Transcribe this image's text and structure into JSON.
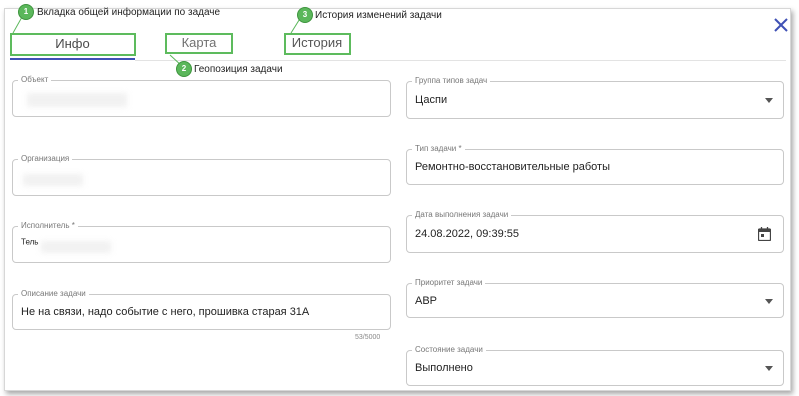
{
  "tabs": {
    "info": "Инфо",
    "map": "Карта",
    "history": "История"
  },
  "annotations": [
    {
      "number": "1",
      "text": "Вкладка общей информации по задаче"
    },
    {
      "number": "2",
      "text": "Геопозиция задачи"
    },
    {
      "number": "3",
      "text": "История изменений задачи"
    }
  ],
  "left_column": {
    "object": {
      "label": "Объект",
      "value": ""
    },
    "organization": {
      "label": "Организация",
      "value": ""
    },
    "executor": {
      "label": "Исполнитель *",
      "value": "Тель"
    },
    "description": {
      "label": "Описание задачи",
      "value": "Не на связи, надо событие с него, прошивка старая 31А",
      "counter": "53/5000"
    }
  },
  "right_column": {
    "task_type_group": {
      "label": "Группа типов задач",
      "value": "Цаспи"
    },
    "task_type": {
      "label": "Тип задачи *",
      "value": "Ремонтно-восстановительные работы"
    },
    "due_date": {
      "label": "Дата выполнения задачи",
      "value": "24.08.2022, 09:39:55"
    },
    "priority": {
      "label": "Приоритет задачи",
      "value": "АВР"
    },
    "status": {
      "label": "Состояние задачи",
      "value": "Выполнено"
    }
  },
  "colors": {
    "accent": "#3f51b5",
    "annotation_green": "#5bb75b"
  }
}
